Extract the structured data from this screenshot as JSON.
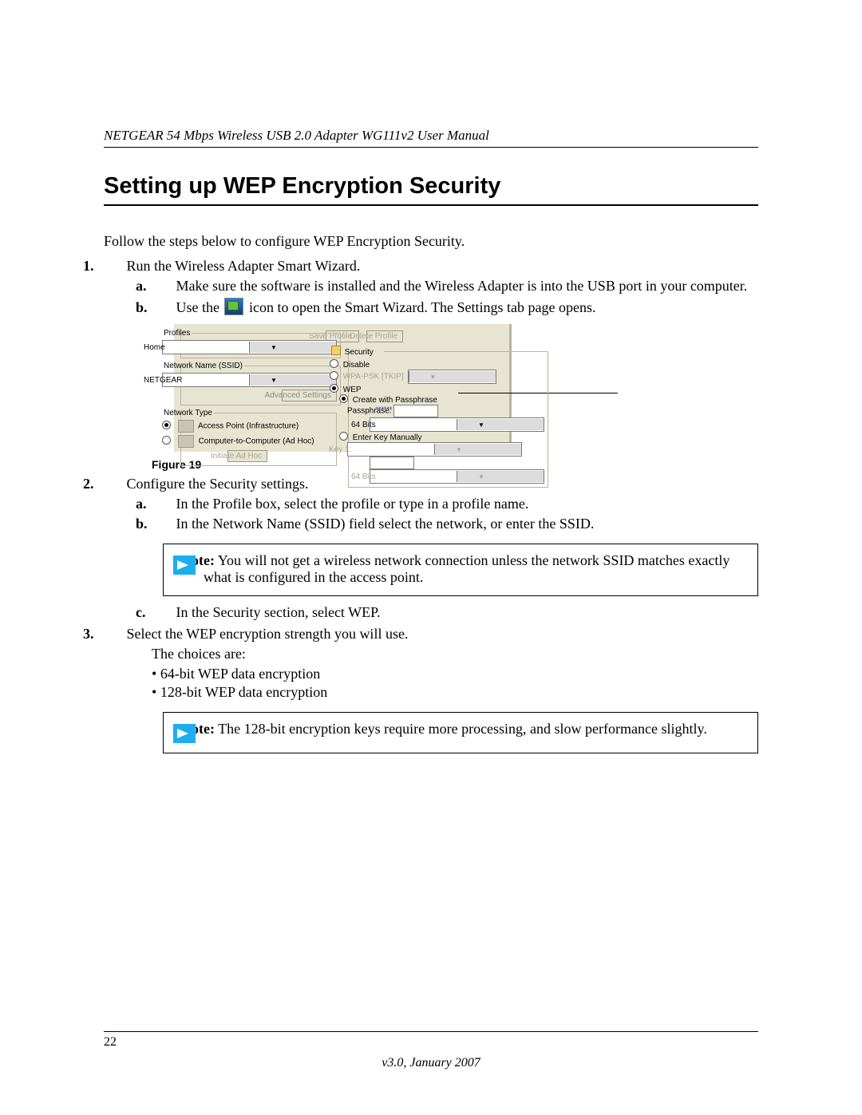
{
  "header": {
    "running_head": "NETGEAR 54 Mbps Wireless USB 2.0 Adapter WG111v2 User Manual"
  },
  "title": "Setting up WEP Encryption Security",
  "intro": "Follow the steps below to configure WEP Encryption Security.",
  "steps": {
    "s1": {
      "num": "1.",
      "text": "Run the Wireless Adapter Smart Wizard.",
      "a": {
        "let": "a.",
        "text": "Make sure the software is installed and the Wireless Adapter is into the USB port in your computer."
      },
      "b": {
        "let": "b.",
        "pre": "Use the",
        "post": "icon to open the Smart Wizard. The Settings tab page opens."
      }
    },
    "s2": {
      "num": "2.",
      "text": "Configure the Security settings.",
      "a": {
        "let": "a.",
        "text": "In the Profile box, select the profile or type in a profile name."
      },
      "b": {
        "let": "b.",
        "text": "In the Network Name (SSID) field select the network, or enter the SSID."
      },
      "c": {
        "let": "c.",
        "text": "In the Security section, select WEP."
      }
    },
    "s3": {
      "num": "3.",
      "text": "Select the WEP encryption strength you will use.",
      "line2": "The choices are:",
      "bul1": "64-bit WEP data encryption",
      "bul2": "128-bit WEP data encryption"
    }
  },
  "figure_caption": "Figure 19",
  "note1": {
    "label": "Note:",
    "text": "You will not get a wireless network connection unless the network SSID matches exactly what is configured in the access point."
  },
  "note2": {
    "label": "Note:",
    "text": "The 128-bit encryption keys require more processing, and slow performance slightly."
  },
  "footer": {
    "page": "22",
    "version": "v3.0, January 2007"
  },
  "dialog": {
    "profiles_legend": "Profiles",
    "profile_value": "Home",
    "save_btn": "Save Profile",
    "delete_btn": "Delete Profile",
    "ssid_legend": "Network Name (SSID)",
    "ssid_value": "NETGEAR",
    "adv_btn": "Advanced Settings",
    "nettype_legend": "Network Type",
    "nt_ap": "Access Point (Infrastructure)",
    "nt_adhoc": "Computer-to-Computer (Ad Hoc)",
    "adhoc_btn": "Initiate Ad Hoc",
    "security_legend": "Security",
    "sec_disable": "Disable",
    "sec_wpa": "WPA-PSK [TKIP]",
    "sec_wep": "WEP",
    "wep_create": "Create with Passphrase",
    "wep_pass_label": "Passphrase:",
    "wep_pass_val": "******",
    "bits": "64 Bits",
    "wep_manual": "Enter Key Manually",
    "key_label": "Key 1:"
  }
}
